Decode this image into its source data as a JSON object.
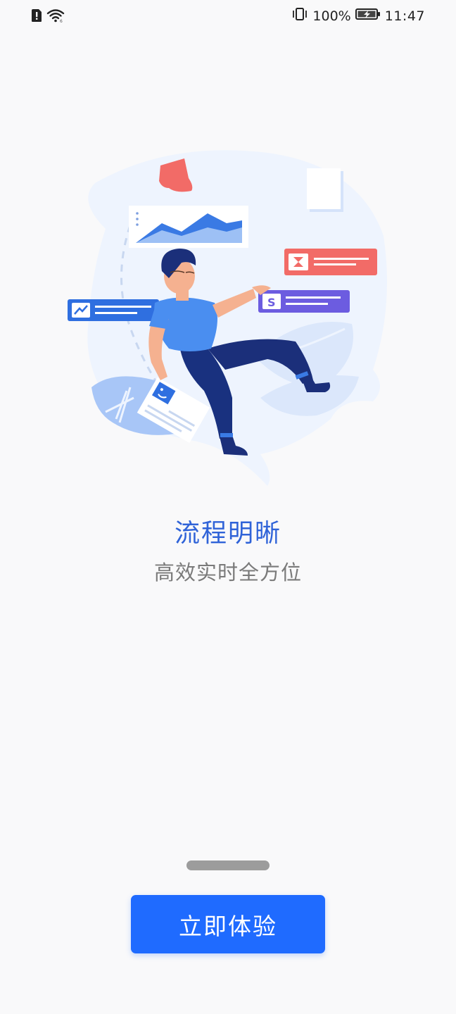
{
  "status_bar": {
    "battery_percent": "100%",
    "time": "11:47",
    "icons": [
      "sim-alert-icon",
      "wifi-icon",
      "vibrate-icon",
      "battery-charging-icon"
    ]
  },
  "onboarding": {
    "title": "流程明晰",
    "subtitle": "高效实时全方位",
    "page_count_indicator": "active"
  },
  "cta": {
    "label": "立即体验"
  },
  "colors": {
    "title": "#2f63d8",
    "subtitle": "#7a7a7a",
    "button": "#1f6bff",
    "indicator": "#9c9c9c",
    "background": "#f9f9fa"
  }
}
